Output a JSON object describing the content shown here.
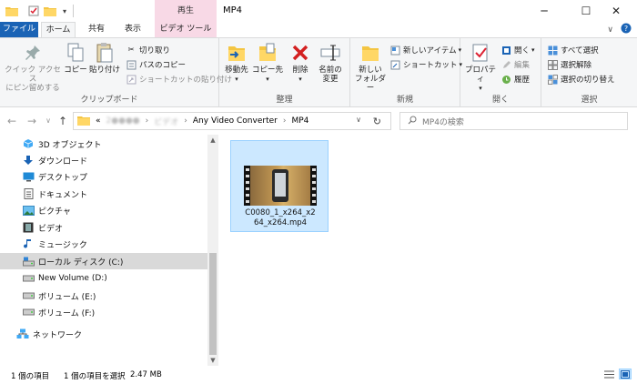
{
  "window": {
    "title": "MP4",
    "context_tab_header": "再生",
    "minimize": "─",
    "maximize": "☐",
    "close": "✕"
  },
  "tabs": {
    "file": "ファイル",
    "home": "ホーム",
    "share": "共有",
    "view": "表示",
    "video_tools": "ビデオ ツール"
  },
  "ribbon": {
    "clipboard": {
      "label": "クリップボード",
      "pin_line1": "クイック アクセス",
      "pin_line2": "にピン留めする",
      "copy": "コピー",
      "paste": "貼り付け",
      "cut": "切り取り",
      "copy_path": "パスのコピー",
      "paste_shortcut": "ショートカットの貼り付け"
    },
    "organize": {
      "label": "整理",
      "move_to": "移動先",
      "copy_to": "コピー先",
      "delete": "削除",
      "rename_line1": "名前の",
      "rename_line2": "変更"
    },
    "new": {
      "label": "新規",
      "new_folder_line1": "新しい",
      "new_folder_line2": "フォルダー",
      "new_item": "新しいアイテム",
      "shortcut": "ショートカット"
    },
    "open": {
      "label": "開く",
      "properties": "プロパティ",
      "open": "開く",
      "edit": "編集",
      "history": "履歴"
    },
    "select": {
      "label": "選択",
      "select_all": "すべて選択",
      "select_none": "選択解除",
      "invert": "選択の切り替え"
    }
  },
  "address": {
    "prefix": "«",
    "blurred1": "2●●●●",
    "blurred2": "ビデオ",
    "crumb1": "Any Video Converter",
    "crumb2": "MP4",
    "search_placeholder": "MP4の検索"
  },
  "nav_tree": [
    {
      "label": "3D オブジェクト",
      "icon": "cube-icon"
    },
    {
      "label": "ダウンロード",
      "icon": "download-icon"
    },
    {
      "label": "デスクトップ",
      "icon": "desktop-icon"
    },
    {
      "label": "ドキュメント",
      "icon": "document-icon"
    },
    {
      "label": "ピクチャ",
      "icon": "picture-icon"
    },
    {
      "label": "ビデオ",
      "icon": "video-icon"
    },
    {
      "label": "ミュージック",
      "icon": "music-icon"
    },
    {
      "label": "ローカル ディスク (C:)",
      "icon": "drive-icon"
    },
    {
      "label": "New Volume (D:)",
      "icon": "drive-icon"
    },
    {
      "label": "ボリューム (E:)",
      "icon": "drive-icon"
    },
    {
      "label": "ボリューム (F:)",
      "icon": "drive-icon"
    },
    {
      "label": "ネットワーク",
      "icon": "network-icon"
    }
  ],
  "file": {
    "name_line1": "C0080_1_x264_x2",
    "name_line2": "64_x264.mp4"
  },
  "status": {
    "count": "1 個の項目",
    "selected": "1 個の項目を選択",
    "size": "2.47 MB"
  },
  "colors": {
    "file_tab": "#1a63b5",
    "context_tab": "#f8d9e6",
    "selection": "#cce8ff"
  }
}
